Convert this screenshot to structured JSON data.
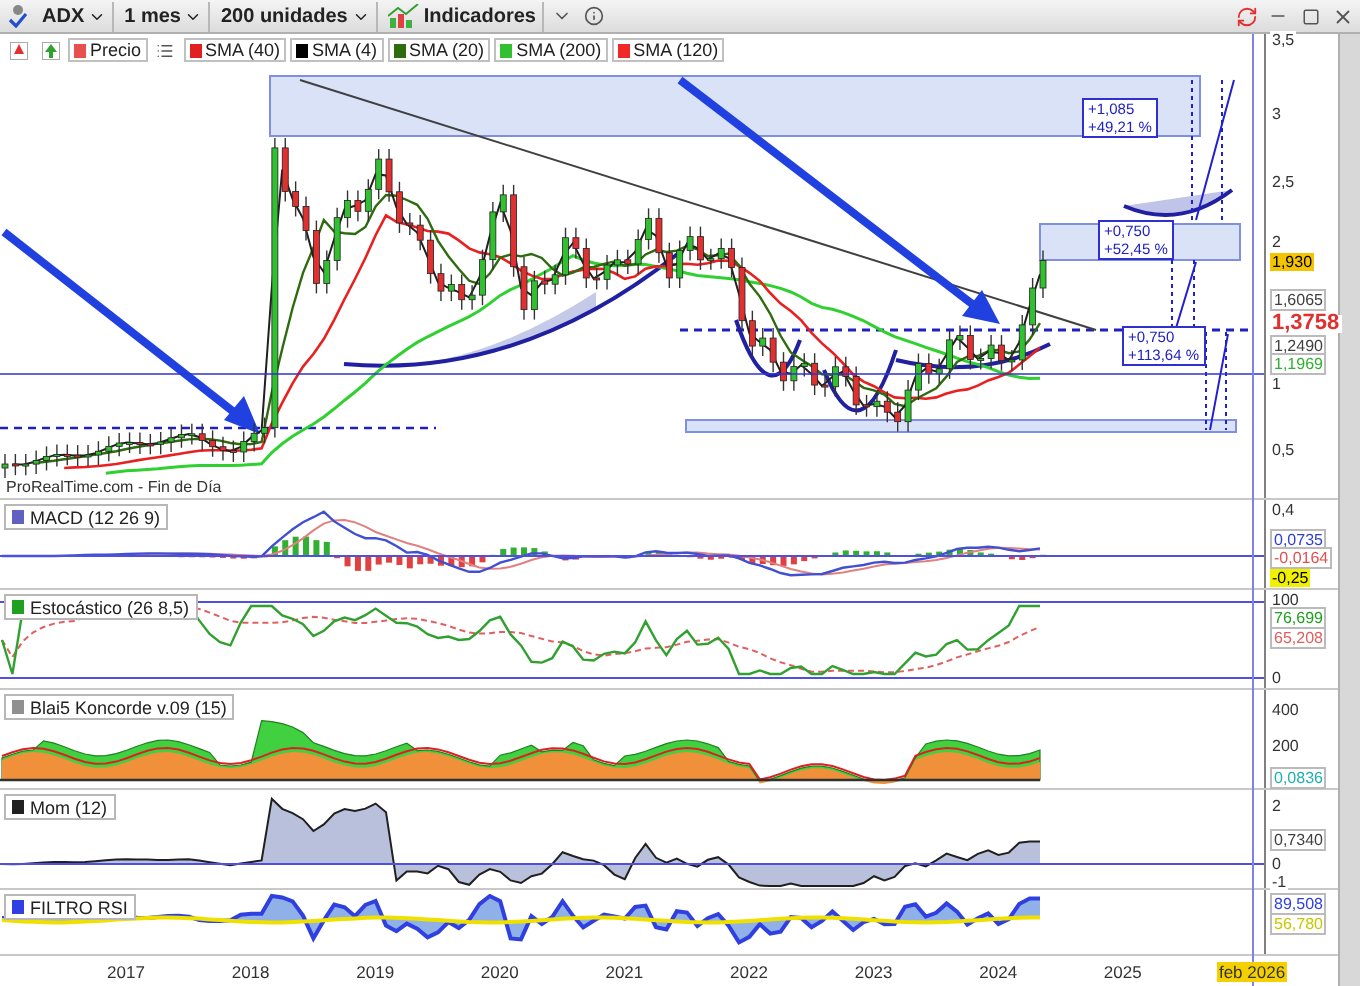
{
  "toolbar": {
    "symbol": "ADX",
    "period": "1 mes",
    "units": "200 unidades",
    "indicators": "Indicadores"
  },
  "legend": [
    {
      "label": "Precio",
      "color": "#e85050"
    },
    {
      "label": "SMA (40)",
      "color": "#e02020"
    },
    {
      "label": "SMA (4)",
      "color": "#000000"
    },
    {
      "label": "SMA (20)",
      "color": "#2e6b0e"
    },
    {
      "label": "SMA (200)",
      "color": "#30c030"
    },
    {
      "label": "SMA (120)",
      "color": "#f02828"
    }
  ],
  "price_panel": {
    "source": "ProRealTime.com - Fin de Día",
    "measures": [
      {
        "change": "+1,085",
        "percent": "+49,21 %"
      },
      {
        "change": "+0,750",
        "percent": "+52,45 %"
      },
      {
        "change": "+0,750",
        "percent": "+113,64 %"
      }
    ],
    "axis": [
      {
        "label": "3,5",
        "kind": "tick"
      },
      {
        "label": "3",
        "kind": "tick"
      },
      {
        "label": "2,5",
        "kind": "tick"
      },
      {
        "label": "2",
        "kind": "tick"
      },
      {
        "label": "1,930",
        "kind": "badge",
        "color": "#f5c400"
      },
      {
        "label": "1,6065",
        "kind": "value",
        "color": "#404040"
      },
      {
        "label": "1,3758",
        "kind": "big",
        "color": "#e03030"
      },
      {
        "label": "1,2490",
        "kind": "value",
        "color": "#404040"
      },
      {
        "label": "1,1969",
        "kind": "value",
        "color": "#30b030"
      },
      {
        "label": "1",
        "kind": "tick"
      },
      {
        "label": "0,5",
        "kind": "tick"
      }
    ]
  },
  "panels": [
    {
      "kind": "macd",
      "title": "MACD (12 26 9)",
      "color": "#6060c0",
      "axis": [
        {
          "label": "0,4",
          "kind": "tick"
        },
        {
          "label": "0,0735",
          "kind": "value",
          "color": "#3040d0"
        },
        {
          "label": "-0,0164",
          "kind": "value",
          "color": "#e05050"
        },
        {
          "label": "-0,25",
          "kind": "badge",
          "color": "#f0f000"
        }
      ]
    },
    {
      "kind": "stochastic",
      "title": "Estocástico (26 8,5)",
      "color": "#20a020",
      "axis": [
        {
          "label": "100",
          "kind": "tick"
        },
        {
          "label": "76,699",
          "kind": "value",
          "color": "#20a020"
        },
        {
          "label": "65,208",
          "kind": "value",
          "color": "#e06060"
        },
        {
          "label": "0",
          "kind": "tick"
        }
      ]
    },
    {
      "kind": "koncorde",
      "title": "Blai5 Koncorde v.09 (15)",
      "color": "#909090",
      "axis": [
        {
          "label": "400",
          "kind": "tick"
        },
        {
          "label": "200",
          "kind": "tick"
        },
        {
          "label": "0,0836",
          "kind": "value",
          "color": "#20b0b0"
        }
      ]
    },
    {
      "kind": "momentum",
      "title": "Mom (12)",
      "color": "#202020",
      "axis": [
        {
          "label": "2",
          "kind": "tick"
        },
        {
          "label": "0,7340",
          "kind": "value",
          "color": "#404040"
        },
        {
          "label": "0",
          "kind": "tick"
        },
        {
          "label": "-1",
          "kind": "tick"
        }
      ]
    },
    {
      "kind": "rsi",
      "title": "FILTRO RSI",
      "color": "#3040e0",
      "axis": [
        {
          "label": "89,508",
          "kind": "value",
          "color": "#3040e0"
        },
        {
          "label": "56,780",
          "kind": "value",
          "color": "#c8c800"
        }
      ]
    }
  ],
  "x_axis": [
    {
      "label": "2017",
      "kind": "year"
    },
    {
      "label": "2018",
      "kind": "year"
    },
    {
      "label": "2019",
      "kind": "year"
    },
    {
      "label": "2020",
      "kind": "year"
    },
    {
      "label": "2021",
      "kind": "year"
    },
    {
      "label": "2022",
      "kind": "year"
    },
    {
      "label": "2023",
      "kind": "year"
    },
    {
      "label": "2024",
      "kind": "year"
    },
    {
      "label": "2025",
      "kind": "year"
    },
    {
      "label": "feb 2026",
      "kind": "cursor"
    }
  ]
}
